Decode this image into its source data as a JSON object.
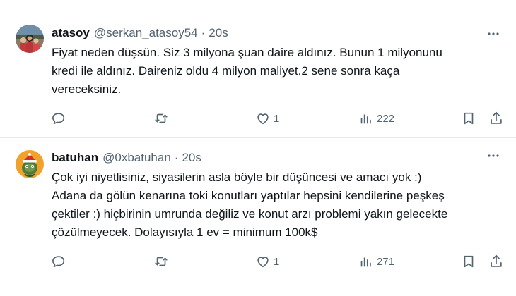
{
  "tweets": [
    {
      "name": "atasoy",
      "handle": "@serkan_atasoy54",
      "separator": "·",
      "time": "20s",
      "text_lines": [
        "Fiyat neden düşsün. Siz 3 milyona şuan daire aldınız. Bunun 1 milyonunu",
        "kredi ile aldınız. Daireniz oldu 4 milyon maliyet.2 sene sonra kaça",
        "vereceksiniz."
      ],
      "replies": "",
      "retweets": "",
      "likes": "1",
      "views": "222"
    },
    {
      "name": "batuhan",
      "handle": "@0xbatuhan",
      "separator": "·",
      "time": "20s",
      "text_lines": [
        "Çok iyi niyetlisiniz, siyasilerin asla böyle bir düşüncesi ve amacı yok :)",
        "Adana da gölün kenarına toki konutları yaptılar hepsini kendilerine peşkeş",
        "çektiler :) hiçbirinin umrunda değiliz ve konut arzı problemi yakın gelecekte",
        "çözülmeyecek. Dolayısıyla 1 ev = minimum 100k$"
      ],
      "replies": "",
      "retweets": "",
      "likes": "1",
      "views": "271"
    }
  ],
  "icons": {
    "reply": "reply-icon",
    "retweet": "retweet-icon",
    "like": "heart-icon",
    "views": "views-icon",
    "bookmark": "bookmark-icon",
    "share": "share-icon",
    "more": "more-icon"
  },
  "colors": {
    "text": "#0f1419",
    "secondary": "#536471",
    "divider": "#e7e9ea"
  }
}
